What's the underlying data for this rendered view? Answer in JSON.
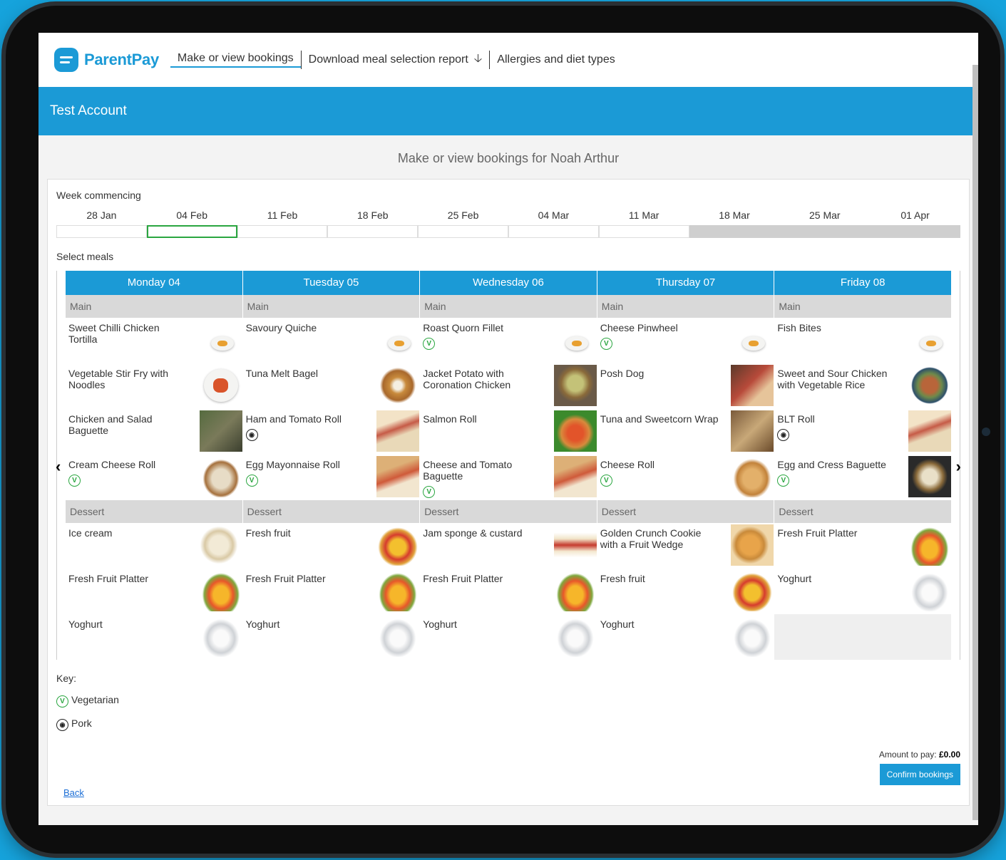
{
  "nav": {
    "logo": "ParentPay",
    "links": [
      "Make or view bookings",
      "Download meal selection report",
      "Allergies and diet types"
    ]
  },
  "banner": "Test Account",
  "subtitle": "Make or view bookings for Noah Arthur",
  "week_label": "Week commencing",
  "weeks": [
    "28 Jan",
    "04 Feb",
    "11 Feb",
    "18 Feb",
    "25 Feb",
    "04 Mar",
    "11 Mar",
    "18 Mar",
    "25 Mar",
    "01 Apr"
  ],
  "select_meals_label": "Select meals",
  "section_labels": {
    "main": "Main",
    "dessert": "Dessert"
  },
  "days": [
    {
      "name": "Monday 04",
      "mains": [
        {
          "name": "Sweet Chilli Chicken Tortilla",
          "diet": "",
          "thumb": "small"
        },
        {
          "name": "Vegetable Stir Fry with Noodles",
          "diet": "",
          "thumb": "noodles"
        },
        {
          "name": "Chicken and Salad Baguette",
          "diet": "",
          "thumb": "wrap"
        },
        {
          "name": "Cream Cheese Roll",
          "diet": "V",
          "thumb": "roll"
        }
      ],
      "desserts": [
        {
          "name": "Ice cream",
          "diet": "",
          "thumb": "icecream"
        },
        {
          "name": "Fresh Fruit Platter",
          "diet": "",
          "thumb": "fruit"
        },
        {
          "name": "Yoghurt",
          "diet": "",
          "thumb": "yoghurt"
        }
      ]
    },
    {
      "name": "Tuesday 05",
      "mains": [
        {
          "name": "Savoury Quiche",
          "diet": "",
          "thumb": "small"
        },
        {
          "name": "Tuna Melt Bagel",
          "diet": "",
          "thumb": "bagel"
        },
        {
          "name": "Ham and Tomato Roll",
          "diet": "P",
          "thumb": "sandwich"
        },
        {
          "name": "Egg Mayonnaise Roll",
          "diet": "V",
          "thumb": "baguette"
        }
      ],
      "desserts": [
        {
          "name": "Fresh fruit",
          "diet": "",
          "thumb": "fruitcup"
        },
        {
          "name": "Fresh Fruit Platter",
          "diet": "",
          "thumb": "fruit"
        },
        {
          "name": "Yoghurt",
          "diet": "",
          "thumb": "yoghurt"
        }
      ]
    },
    {
      "name": "Wednesday 06",
      "mains": [
        {
          "name": "Roast Quorn Fillet",
          "diet": "V",
          "thumb": "small"
        },
        {
          "name": "Jacket Potato with Coronation Chicken",
          "diet": "",
          "thumb": "potato"
        },
        {
          "name": "Salmon Roll",
          "diet": "",
          "thumb": "burger"
        },
        {
          "name": "Cheese and Tomato Baguette",
          "diet": "V",
          "thumb": "baguette"
        }
      ],
      "desserts": [
        {
          "name": "Jam sponge & custard",
          "diet": "",
          "thumb": "cake"
        },
        {
          "name": "Fresh Fruit Platter",
          "diet": "",
          "thumb": "fruit"
        },
        {
          "name": "Yoghurt",
          "diet": "",
          "thumb": "yoghurt"
        }
      ]
    },
    {
      "name": "Thursday 07",
      "mains": [
        {
          "name": "Cheese Pinwheel",
          "diet": "V",
          "thumb": "small"
        },
        {
          "name": "Posh Dog",
          "diet": "",
          "thumb": "hotdog"
        },
        {
          "name": "Tuna and Sweetcorn Wrap",
          "diet": "",
          "thumb": "wrap2"
        },
        {
          "name": "Cheese Roll",
          "diet": "V",
          "thumb": "bun"
        }
      ],
      "desserts": [
        {
          "name": "Golden Crunch Cookie with a Fruit Wedge",
          "diet": "",
          "thumb": "cookie"
        },
        {
          "name": "Fresh fruit",
          "diet": "",
          "thumb": "fruitcup"
        },
        {
          "name": "Yoghurt",
          "diet": "",
          "thumb": "yoghurt"
        }
      ]
    },
    {
      "name": "Friday 08",
      "mains": [
        {
          "name": "Fish Bites",
          "diet": "",
          "thumb": "small"
        },
        {
          "name": "Sweet and Sour Chicken with Vegetable Rice",
          "diet": "",
          "thumb": "bowl"
        },
        {
          "name": "BLT Roll",
          "diet": "P",
          "thumb": "sandwich"
        },
        {
          "name": "Egg and Cress Baguette",
          "diet": "V",
          "thumb": "dark"
        }
      ],
      "desserts": [
        {
          "name": "Fresh Fruit Platter",
          "diet": "",
          "thumb": "fruit"
        },
        {
          "name": "Yoghurt",
          "diet": "",
          "thumb": "yoghurt"
        }
      ]
    }
  ],
  "key": {
    "label": "Key:",
    "vegetarian": "Vegetarian",
    "pork": "Pork"
  },
  "amount_label": "Amount to pay:",
  "amount_value": "£0.00",
  "confirm_label": "Confirm bookings",
  "back_label": "Back",
  "colors": {
    "brand": "#1b9ad6",
    "vegetarian": "#2aa640",
    "background": "#16a3dc"
  }
}
